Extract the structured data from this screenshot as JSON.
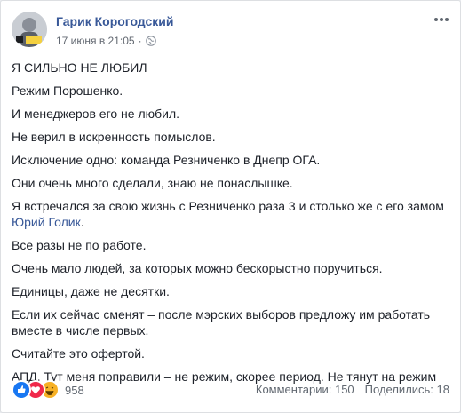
{
  "post": {
    "author": "Гарик Корогодский",
    "timestamp": "17 июня в 21:05",
    "dot": "·",
    "privacy_icon": "globe-icon",
    "more_icon": "more-horizontal-icon",
    "paragraphs": [
      "Я СИЛЬНО НЕ ЛЮБИЛ",
      "Режим Порошенко.",
      "И менеджеров его не любил.",
      "Не верил в искренность помыслов.",
      "Исключение одно: команда Резниченко в Днепр ОГА.",
      "Они очень много сделали, знаю не понаслышке."
    ],
    "mention_paragraph": {
      "text": "Я встречался за свою жизнь с Резниченко раза 3 и столько же с его замом ",
      "link": "Юрий Голик",
      "after": "."
    },
    "paragraphs_after": [
      "Все разы не по работе.",
      "Очень мало людей, за которых можно бескорыстно поручиться.",
      "Единицы, даже не десятки.",
      "Если их сейчас сменят – после мэрских выборов предложу им работать вместе в числе первых.",
      "Считайте это офертой.",
      "АПД. Тут меня поправили – не режим, скорее период. Не тянут на режим"
    ]
  },
  "footer": {
    "reaction_icons": [
      "like-icon",
      "love-icon",
      "haha-icon"
    ],
    "reaction_count": "958",
    "comments": "Комментарии: 150",
    "shares": "Поделились: 18"
  },
  "colors": {
    "link": "#385898",
    "text": "#1d2129",
    "meta": "#616770",
    "like": "#1877f2",
    "love": "#f0284a",
    "haha": "#f7b125"
  }
}
